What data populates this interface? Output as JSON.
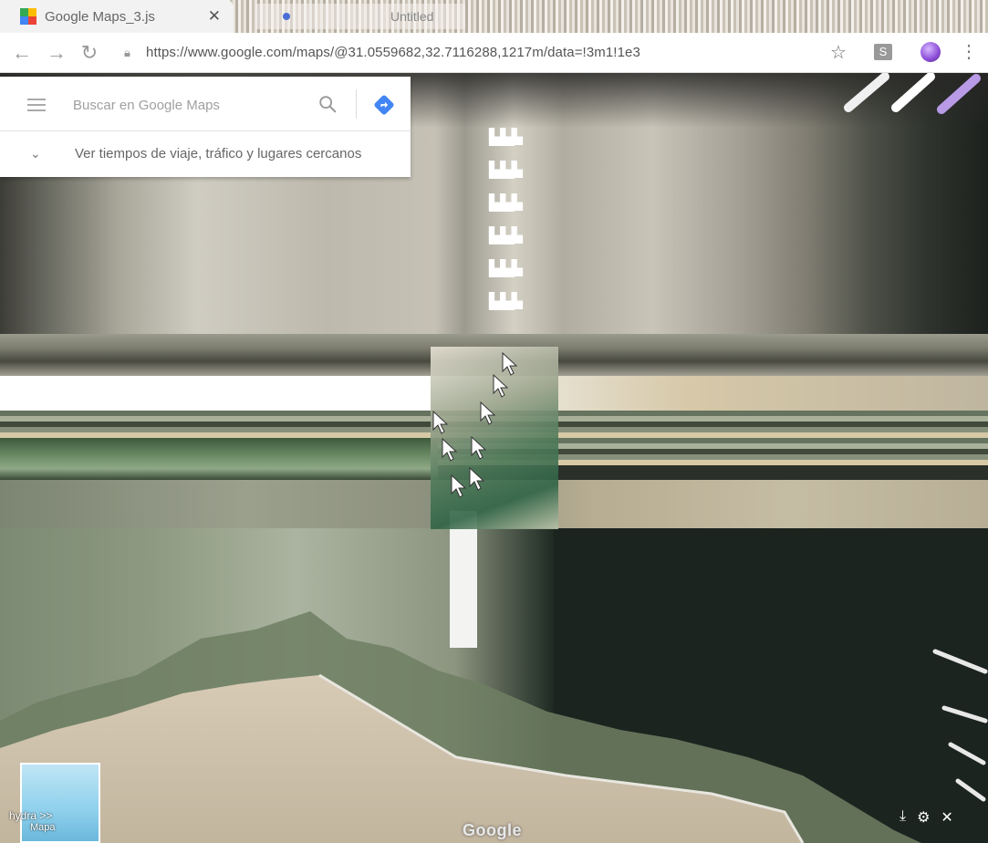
{
  "browser": {
    "active_tab_title": "Google Maps_3.js",
    "inactive_tab_title": "Untitled",
    "tab_marker": "1",
    "url": "https://www.google.com/maps/@31.0559682,32.7116288,1217m/data=!3m1!1e3",
    "extension_label": "S"
  },
  "search": {
    "placeholder": "Buscar en Google Maps",
    "value": "",
    "hint": "Ver tiempos de viaje, tráfico y lugares cercanos"
  },
  "map": {
    "layer_label": "hydra >>",
    "layer_label2": "Mapa",
    "watermark": "Google"
  },
  "icons": {
    "back": "arrow-left-icon",
    "forward": "arrow-right-icon",
    "reload": "reload-icon",
    "star": "star-icon",
    "menu": "menu-icon",
    "search": "search-icon",
    "directions": "directions-icon"
  }
}
